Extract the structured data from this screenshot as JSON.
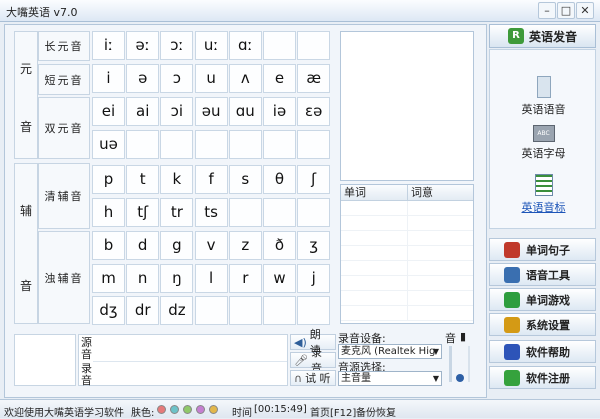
{
  "window": {
    "title": "大嘴英语 v7.0"
  },
  "vowels": {
    "label_top": "元",
    "label_bottom": "音",
    "groups": [
      {
        "label": "长元音",
        "symbols": [
          "iː",
          "əː",
          "ɔː",
          "uː",
          "ɑː",
          "",
          "",
          ""
        ]
      },
      {
        "label": "短元音",
        "symbols": [
          "i",
          "ə",
          "ɔ",
          "u",
          "ʌ",
          "e",
          "æ",
          ""
        ]
      },
      {
        "label": "双元音",
        "symbols": [
          "ei",
          "ai",
          "ɔi",
          "əu",
          "ɑu",
          "iə",
          "εə",
          "",
          "uə",
          "",
          "",
          "",
          "",
          "",
          "",
          ""
        ]
      }
    ]
  },
  "consonants": {
    "label_top": "辅",
    "label_bottom": "音",
    "groups": [
      {
        "label": "清辅音",
        "symbols": [
          "p",
          "t",
          "k",
          "f",
          "s",
          "θ",
          "ʃ",
          "",
          "h",
          "tʃ",
          "tr",
          "ts",
          "",
          "",
          "",
          ""
        ]
      },
      {
        "label": "浊辅音",
        "symbols": [
          "b",
          "d",
          "g",
          "v",
          "z",
          "ð",
          "ʒ",
          "",
          "m",
          "n",
          "ŋ",
          "l",
          "r",
          "w",
          "j",
          "",
          "dʒ",
          "dr",
          "dz",
          "",
          "",
          "",
          "",
          ""
        ]
      }
    ]
  },
  "word_list": {
    "col_word": "单词",
    "col_meaning": "词意"
  },
  "source": {
    "source_label": "源音",
    "record_label": "录音"
  },
  "controls": {
    "read": "朗 读",
    "record": "录 音",
    "listen": "试 听"
  },
  "recording": {
    "device_label": "录音设备:",
    "device_value": "麦克风 (Realtek Hig",
    "source_label": "音源选择:",
    "source_value": "主音量",
    "vol_label": "音"
  },
  "right_panel": {
    "tab_title": "英语发音",
    "nav": [
      {
        "label": "英语语音",
        "icon": "book-icon"
      },
      {
        "label": "英语字母",
        "icon": "abc-icon"
      },
      {
        "label": "英语音标",
        "icon": "checklist-icon"
      }
    ],
    "buttons": [
      {
        "label": "单词句子",
        "icon": "books-icon",
        "color": "#c0392b"
      },
      {
        "label": "语音工具",
        "icon": "tools-icon",
        "color": "#3a6fb0"
      },
      {
        "label": "单词游戏",
        "icon": "game-icon",
        "color": "#2e9e3e"
      },
      {
        "label": "系统设置",
        "icon": "settings-icon",
        "color": "#d49a15"
      },
      {
        "label": "软件帮助",
        "icon": "help-icon",
        "color": "#2d54b8"
      },
      {
        "label": "软件注册",
        "icon": "register-icon",
        "color": "#35a23d"
      }
    ]
  },
  "status": {
    "welcome": "欢迎使用大嘴英语学习软件",
    "skin_label": "肤色:",
    "skin_colors": [
      "#e67a7a",
      "#6cc2c8",
      "#8fc86a",
      "#c57fd1",
      "#e2b74b"
    ],
    "time_label": "时间",
    "time_value": "[00:15:49]",
    "home": "首页[F12]",
    "backup": "备份",
    "restore": "恢复"
  }
}
